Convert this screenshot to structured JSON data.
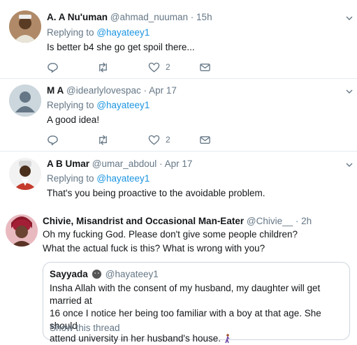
{
  "tweets": [
    {
      "name": "A. A Nu'uman",
      "handle": "@ahmad_nuuman",
      "time": "15h",
      "replying_prefix": "Replying to",
      "replying_to": "@hayateey1",
      "text": "Is better b4 she go get spoil there...",
      "likes": "2"
    },
    {
      "name": "M A",
      "handle": "@idearlylovespac",
      "time": "Apr 17",
      "replying_prefix": "Replying to",
      "replying_to": "@hayateey1",
      "text": "A good idea!",
      "likes": "2"
    },
    {
      "name": "A B Umar",
      "handle": "@umar_abdoul",
      "time": "Apr 17",
      "replying_prefix": "Replying to",
      "replying_to": "@hayateey1",
      "text": "That's you being proactive to the avoidable problem."
    },
    {
      "name": "Chivie, Misandrist and Occasional Man-Eater",
      "handle": "@Chivie__",
      "time": "2h",
      "text_lines": [
        "Oh my fucking God. Please don't give some people children?",
        "What the actual fuck is this? What is wrong with you?"
      ]
    }
  ],
  "quoted": {
    "name": "Sayyada",
    "handle": "@hayateey1",
    "text_lines": [
      "Insha Allah with the consent of my husband, my daughter will get married at",
      "16 once I notice her being too familiar with a boy at that age. She should",
      "attend university in her husband's house."
    ],
    "show_thread": "Show this thread"
  },
  "separator": "·",
  "colors": {
    "link": "#1b95e0",
    "secondary": "#657786",
    "border": "#e6ecf0",
    "name": "#14171a"
  }
}
